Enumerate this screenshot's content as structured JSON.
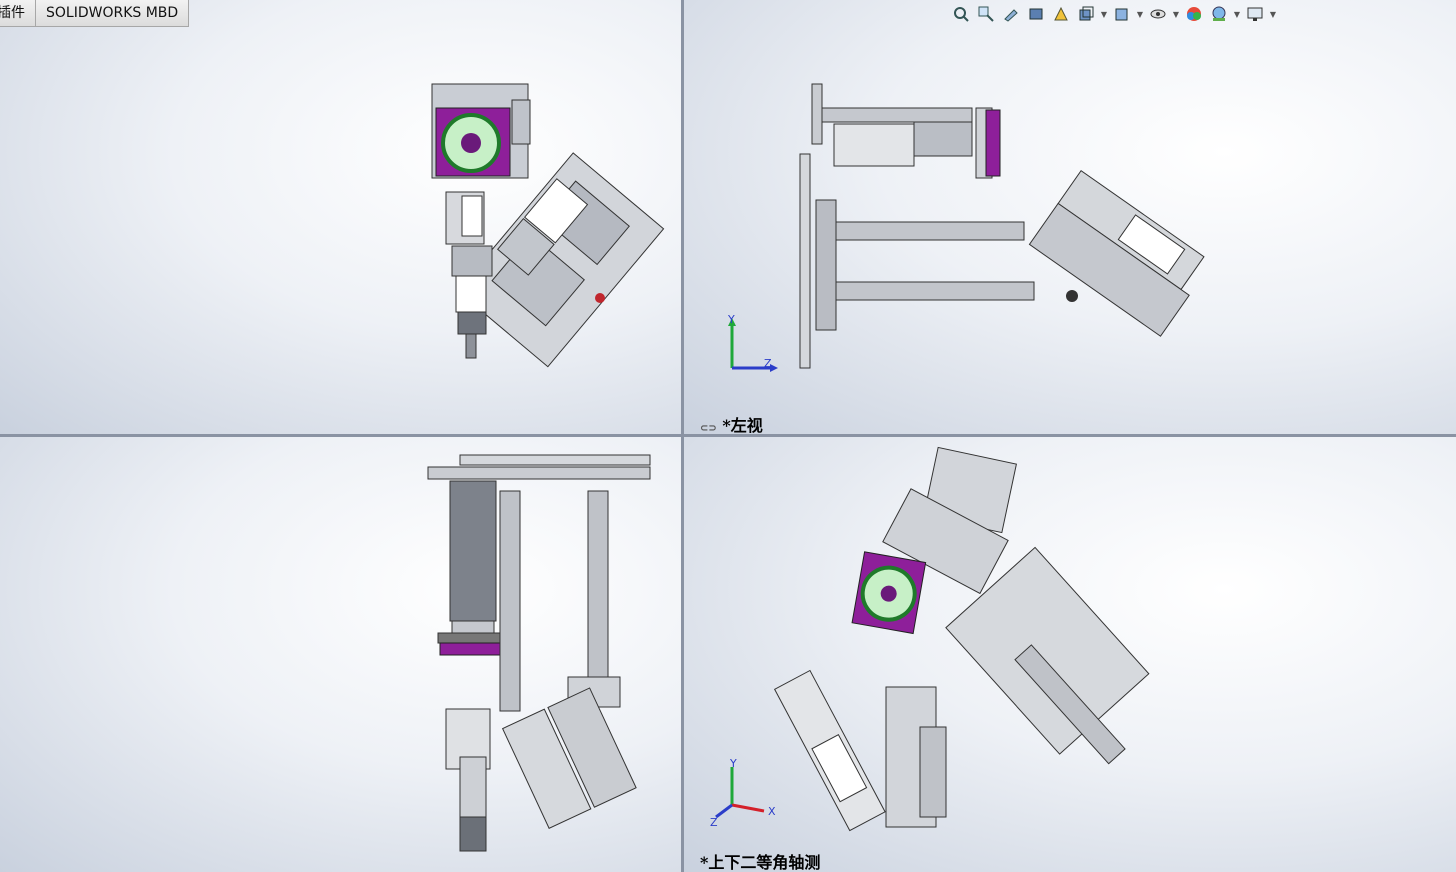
{
  "tabs": [
    "插件",
    "SOLIDWORKS MBD"
  ],
  "toolbar": {
    "icons": [
      "zoom-to-fit-icon",
      "zoom-area-icon",
      "previous-view-icon",
      "section-view-icon",
      "dynamic-annotation-icon",
      "view-orientation-icon",
      "display-style-icon",
      "hide-show-items-icon",
      "edit-appearance-icon",
      "apply-scene-icon",
      "view-settings-icon"
    ]
  },
  "viewports": {
    "top_right": {
      "label": "*左视"
    },
    "bottom_right": {
      "label": "*上下二等角轴测"
    }
  },
  "triad": {
    "x": "X",
    "y": "Y",
    "z": "Z"
  },
  "colors": {
    "accent_purple": "#8e1f9a",
    "fan_green": "#3aa34a",
    "steel": "#9aa0aa",
    "axis_x": "#d4202a",
    "axis_y": "#1fa83a",
    "axis_z": "#2b3dc9"
  }
}
